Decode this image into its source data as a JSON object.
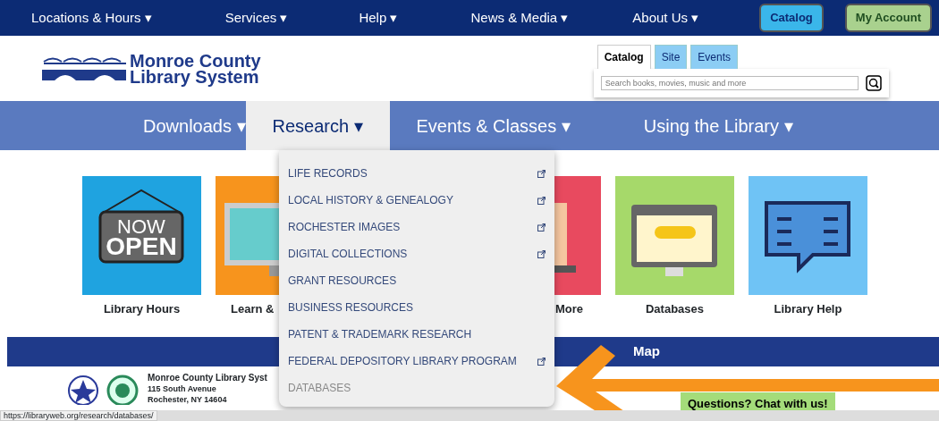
{
  "top_nav": {
    "items": [
      "Locations & Hours",
      "Services",
      "Help",
      "News & Media",
      "About Us"
    ],
    "caret": "▾",
    "buttons": [
      {
        "label": "Catalog",
        "kind": "catalog"
      },
      {
        "label": "My Account",
        "kind": "account"
      }
    ]
  },
  "logo": {
    "line1": "Monroe County",
    "line2": "Library System"
  },
  "search": {
    "tabs": [
      {
        "label": "Catalog",
        "selected": true
      },
      {
        "label": "Site",
        "selected": false
      },
      {
        "label": "Events",
        "selected": false
      }
    ],
    "placeholder": "Search books, movies, music and more"
  },
  "main_nav": [
    {
      "label": "Downloads",
      "selected": false
    },
    {
      "label": "Research",
      "selected": true
    },
    {
      "label": "Events & Classes",
      "selected": false
    },
    {
      "label": "Using the Library",
      "selected": false
    }
  ],
  "dropdown": [
    {
      "label": "LIFE RECORDS",
      "external": true,
      "selected": false
    },
    {
      "label": "LOCAL HISTORY & GENEALOGY",
      "external": true,
      "selected": false
    },
    {
      "label": "ROCHESTER IMAGES",
      "external": true,
      "selected": false
    },
    {
      "label": "DIGITAL COLLECTIONS",
      "external": true,
      "selected": false
    },
    {
      "label": "GRANT RESOURCES",
      "external": false,
      "selected": false
    },
    {
      "label": "BUSINESS RESOURCES",
      "external": false,
      "selected": false
    },
    {
      "label": "PATENT & TRADEMARK RESEARCH",
      "external": false,
      "selected": false
    },
    {
      "label": "FEDERAL DEPOSITORY LIBRARY PROGRAM",
      "external": true,
      "selected": false
    },
    {
      "label": "DATABASES",
      "external": false,
      "selected": true
    }
  ],
  "tiles": [
    {
      "label": "Library Hours",
      "kind": "sign",
      "color": "#1fa3e0"
    },
    {
      "label": "Learn &",
      "kind": "learn",
      "color": "#f7941d"
    },
    {
      "label": "More",
      "kind": "media",
      "color": "#e84a5f"
    },
    {
      "label": "Databases",
      "kind": "web",
      "color": "#a6d96a"
    },
    {
      "label": "Library Help",
      "kind": "help",
      "color": "#6fc3f5"
    }
  ],
  "sign_text": {
    "line1": "NOW",
    "line2": "OPEN"
  },
  "banner": {
    "label": "Map"
  },
  "footer": {
    "name": "Monroe County Library Syst",
    "street": "115 South Avenue",
    "city": "Rochester, NY 14604",
    "chat": "Questions? Chat with us!"
  },
  "status_bar": {
    "url": "https://libraryweb.org/research/databases/"
  }
}
